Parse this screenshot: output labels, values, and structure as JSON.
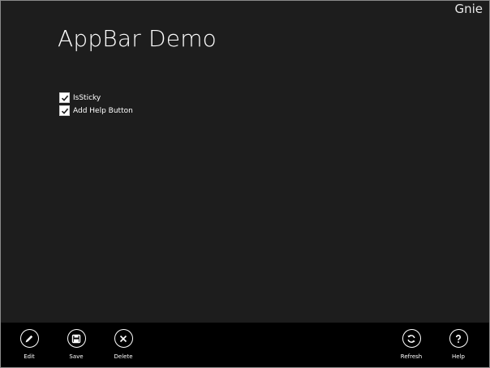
{
  "header": {
    "user_name": "Gnie",
    "title": "AppBar Demo"
  },
  "options": [
    {
      "label": "IsSticky",
      "checked": true
    },
    {
      "label": "Add Help Button",
      "checked": true
    }
  ],
  "appbar": {
    "left": [
      {
        "label": "Edit",
        "icon": "pencil-icon"
      },
      {
        "label": "Save",
        "icon": "floppy-disk-icon"
      },
      {
        "label": "Delete",
        "icon": "cross-icon"
      }
    ],
    "right": [
      {
        "label": "Refresh",
        "icon": "refresh-icon"
      },
      {
        "label": "Help",
        "icon": "question-mark-icon"
      }
    ]
  },
  "colors": {
    "background": "#1d1d1d",
    "appbar": "#000000",
    "text": "#ffffff"
  }
}
